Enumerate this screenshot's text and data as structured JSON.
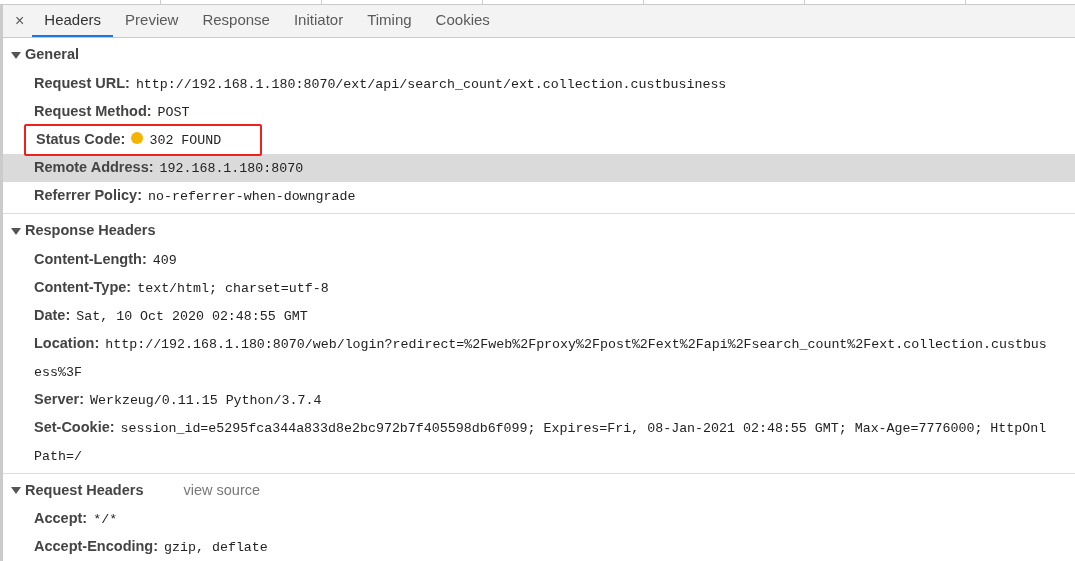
{
  "close_label": "×",
  "tabs": [
    {
      "label": "Headers",
      "selected": true
    },
    {
      "label": "Preview",
      "selected": false
    },
    {
      "label": "Response",
      "selected": false
    },
    {
      "label": "Initiator",
      "selected": false
    },
    {
      "label": "Timing",
      "selected": false
    },
    {
      "label": "Cookies",
      "selected": false
    }
  ],
  "sections": [
    {
      "title": "General",
      "expanded": true,
      "rows": [
        {
          "name": "Request URL:",
          "value_lines": [
            "http://192.168.1.180:8070/ext/api/search_count/ext.collection.custbusiness"
          ],
          "selected": false,
          "highlighted": false
        },
        {
          "name": "Request Method:",
          "value_lines": [
            "POST"
          ],
          "selected": false,
          "highlighted": false
        },
        {
          "name": "Status Code:",
          "value_lines": [
            "302 FOUND"
          ],
          "color": "#f5b400",
          "selected": false,
          "highlighted": true
        },
        {
          "name": "Remote Address:",
          "value_lines": [
            "192.168.1.180:8070"
          ],
          "selected": true,
          "highlighted": false
        },
        {
          "name": "Referrer Policy:",
          "value_lines": [
            "no-referrer-when-downgrade"
          ],
          "selected": false,
          "highlighted": false
        }
      ]
    },
    {
      "title": "Response Headers",
      "expanded": true,
      "rows": [
        {
          "name": "Content-Length:",
          "value_lines": [
            "409"
          ],
          "selected": false,
          "highlighted": false
        },
        {
          "name": "Content-Type:",
          "value_lines": [
            "text/html; charset=utf-8"
          ],
          "selected": false,
          "highlighted": false
        },
        {
          "name": "Date:",
          "value_lines": [
            "Sat, 10 Oct 2020 02:48:55 GMT"
          ],
          "selected": false,
          "highlighted": false
        },
        {
          "name": "Location:",
          "value_lines": [
            "http://192.168.1.180:8070/web/login?redirect=%2Fweb%2Fproxy%2Fpost%2Fext%2Fapi%2Fsearch_count%2Fext.collection.custbus",
            "ess%3F"
          ],
          "selected": false,
          "highlighted": false
        },
        {
          "name": "Server:",
          "value_lines": [
            "Werkzeug/0.11.15 Python/3.7.4"
          ],
          "selected": false,
          "highlighted": false
        },
        {
          "name": "Set-Cookie:",
          "value_lines": [
            "session_id=e5295fca344a833d8e2bc972b7f405598db6f099; Expires=Fri, 08-Jan-2021 02:48:55 GMT; Max-Age=7776000; HttpOnl",
            "Path=/"
          ],
          "selected": false,
          "highlighted": false
        }
      ]
    },
    {
      "title": "Request Headers",
      "expanded": true,
      "link": "view source",
      "rows": [
        {
          "name": "Accept:",
          "value_lines": [
            "*/*"
          ],
          "selected": false,
          "highlighted": false
        },
        {
          "name": "Accept-Encoding:",
          "value_lines": [
            "gzip, deflate"
          ],
          "selected": false,
          "highlighted": false
        }
      ]
    }
  ]
}
